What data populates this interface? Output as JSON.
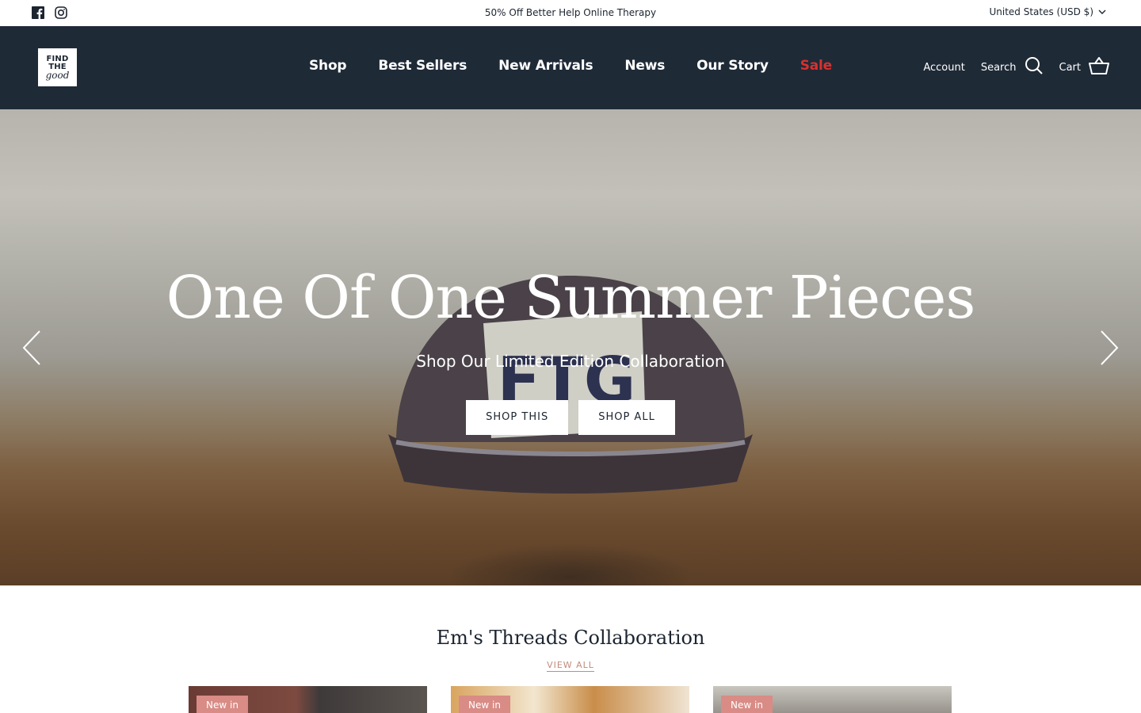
{
  "topbar": {
    "social_icons": [
      "facebook-icon",
      "instagram-icon"
    ],
    "announcement": "50% Off Better Help Online Therapy",
    "country": "United States (USD $)"
  },
  "header": {
    "logo_line1": "FIND",
    "logo_line2": "THE",
    "logo_line3": "good",
    "nav": [
      "Shop",
      "Best Sellers",
      "New Arrivals",
      "News",
      "Our Story",
      "Sale"
    ],
    "account": "Account",
    "search": "Search",
    "cart": "Cart",
    "sale_color": "#d9302e",
    "header_bg": "#1f2a37"
  },
  "hero": {
    "title": "One Of One Summer Pieces",
    "subtitle": "Shop Our Limited Edition Collaboration",
    "buttons": [
      "SHOP THIS",
      "SHOP ALL"
    ],
    "cap_patch_text": "FTG"
  },
  "collection": {
    "title": "Em's Threads Collaboration",
    "view_all": "VIEW ALL",
    "cards": [
      {
        "badge": "New in"
      },
      {
        "badge": "New in"
      },
      {
        "badge": "New in"
      }
    ],
    "badge_color": "#d98b85",
    "link_color": "#c28b7c"
  }
}
